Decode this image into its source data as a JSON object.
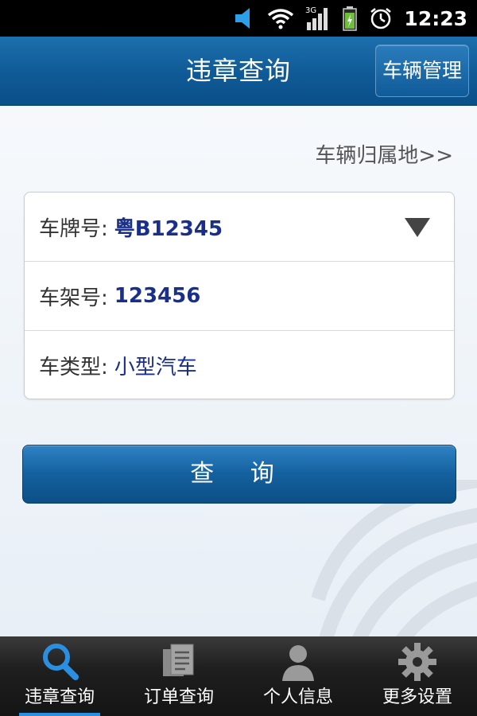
{
  "status_bar": {
    "time": "12:23",
    "network_label": "3G"
  },
  "header": {
    "title": "违章查询",
    "manage_button": "车辆管理"
  },
  "location_link": "车辆归属地>>",
  "form": {
    "plate": {
      "label": "车牌号:",
      "value": "粤B12345"
    },
    "frame": {
      "label": "车架号:",
      "value": "123456"
    },
    "type": {
      "label": "车类型:",
      "value": "小型汽车"
    }
  },
  "query_button": "查 询",
  "nav": [
    {
      "label": "违章查询",
      "icon": "search-icon",
      "active": true
    },
    {
      "label": "订单查询",
      "icon": "document-icon",
      "active": false
    },
    {
      "label": "个人信息",
      "icon": "person-icon",
      "active": false
    },
    {
      "label": "更多设置",
      "icon": "gear-icon",
      "active": false
    }
  ]
}
